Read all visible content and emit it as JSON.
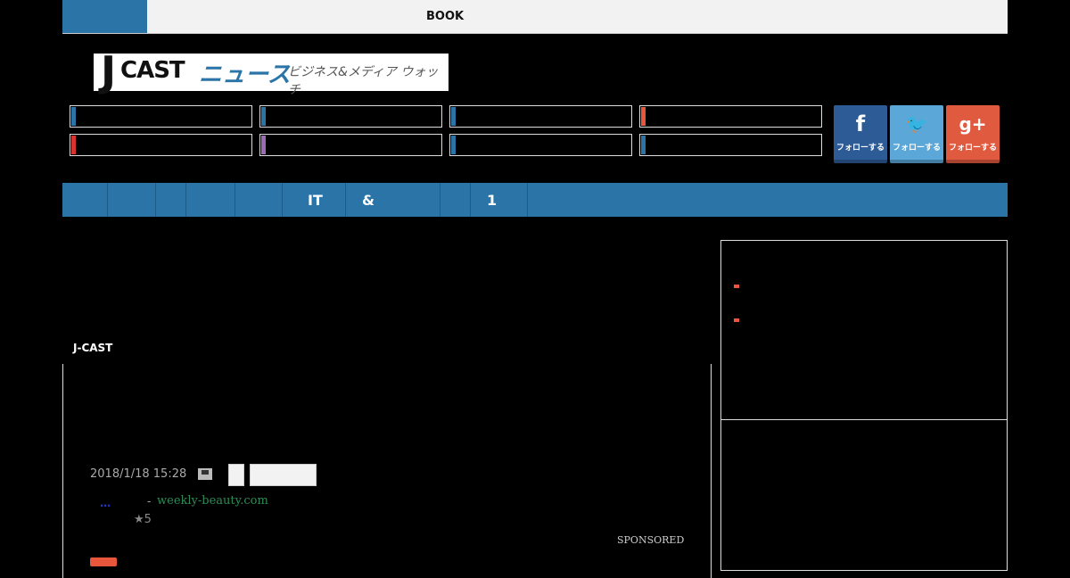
{
  "topbar": {
    "book_label": "BOOK"
  },
  "logo": {
    "j": "J",
    "cast": "CAST",
    "news": "ニュース",
    "tagline": "ビジネス&メディア ウォッチ"
  },
  "categories": [
    {
      "color": "#2a74a8"
    },
    {
      "color": "#2a74a8"
    },
    {
      "color": "#2a74a8"
    },
    {
      "color": "#e8573c"
    },
    {
      "color": "#d63333"
    },
    {
      "color": "#9b6bb5"
    },
    {
      "color": "#2a74a8"
    },
    {
      "color": "#2a74a8"
    }
  ],
  "social": {
    "facebook": {
      "icon": "f",
      "label": "フォローする",
      "color": "#2d5b96"
    },
    "twitter": {
      "icon": "🐦",
      "label": "フォローする",
      "color": "#5aa7d8"
    },
    "google": {
      "icon": "g+",
      "label": "フォローする",
      "color": "#e05a3f"
    }
  },
  "nav": {
    "items": [
      "IT",
      "&",
      "1"
    ]
  },
  "article": {
    "source_label": "J-CAST",
    "date": "2018/1/18 15:28",
    "ad_dots": "…",
    "ad_dash": "-",
    "ad_source": "weekly-beauty.com",
    "ad_rating": "★5",
    "sponsored": "SPONSORED"
  }
}
